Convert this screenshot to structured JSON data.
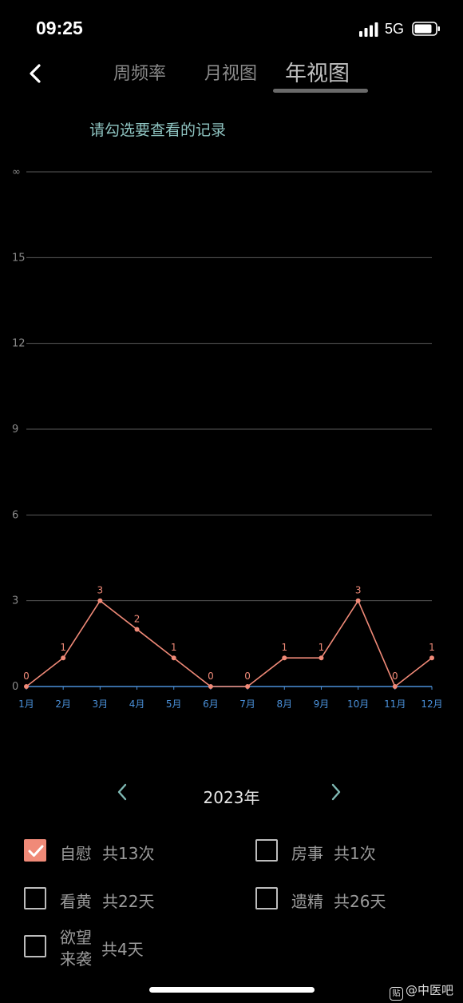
{
  "status_bar": {
    "time": "09:25",
    "network": "5G",
    "signal_icon": "signal-bars-icon",
    "battery_icon": "battery-icon"
  },
  "nav": {
    "back_icon": "chevron-left-icon",
    "tabs": [
      {
        "label": "周频率",
        "active": false
      },
      {
        "label": "月视图",
        "active": false
      },
      {
        "label": "年视图",
        "active": true
      }
    ]
  },
  "hint": "请勾选要查看的记录",
  "chart_data": {
    "type": "line",
    "categories": [
      "1月",
      "2月",
      "3月",
      "4月",
      "5月",
      "6月",
      "7月",
      "8月",
      "9月",
      "10月",
      "11月",
      "12月"
    ],
    "series": [
      {
        "values": [
          0,
          1,
          3,
          2,
          1,
          0,
          0,
          1,
          1,
          3,
          0,
          1
        ],
        "color": "#f08a78"
      }
    ],
    "y_ticks": [
      "0",
      "3",
      "6",
      "9",
      "12",
      "15",
      "∞"
    ],
    "ylim": [
      0,
      18
    ],
    "grid": true,
    "axis_color": "#4a90d9",
    "grid_color": "#5a5a5a",
    "data_labels": true
  },
  "year_nav": {
    "prev_icon": "chevron-left-icon",
    "next_icon": "chevron-right-icon",
    "year": "2023年",
    "accent": "#7fb9b4"
  },
  "records": [
    {
      "name": "自慰",
      "total": "共13次",
      "checked": true
    },
    {
      "name": "房事",
      "total": "共1次",
      "checked": false
    },
    {
      "name": "看黄",
      "total": "共22天",
      "checked": false
    },
    {
      "name": "遗精",
      "total": "共26天",
      "checked": false
    },
    {
      "name_line1": "欲望",
      "name_line2": "来袭",
      "total": "共4天",
      "checked": false
    }
  ],
  "colors": {
    "background": "#000000",
    "checked": "#f08a78"
  },
  "watermark": {
    "logo": "贴",
    "text": "@中医吧"
  }
}
